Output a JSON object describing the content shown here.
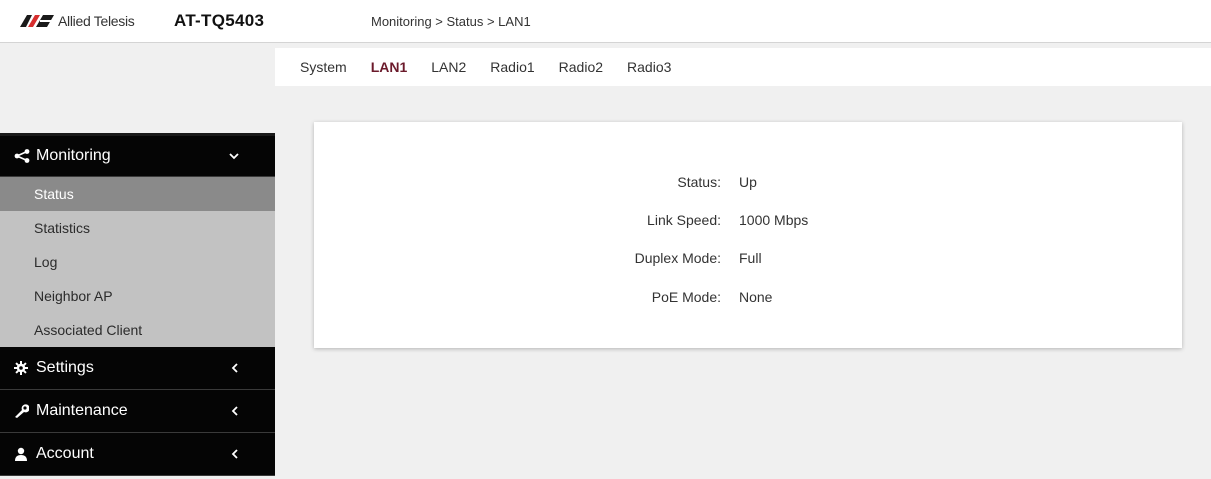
{
  "header": {
    "logo_text": "Allied Telesis",
    "model": "AT-TQ5403",
    "breadcrumb": "Monitoring > Status > LAN1"
  },
  "tabs": [
    {
      "label": "System",
      "active": false
    },
    {
      "label": "LAN1",
      "active": true
    },
    {
      "label": "LAN2",
      "active": false
    },
    {
      "label": "Radio1",
      "active": false
    },
    {
      "label": "Radio2",
      "active": false
    },
    {
      "label": "Radio3",
      "active": false
    }
  ],
  "sidebar": {
    "monitoring": {
      "label": "Monitoring",
      "icon": "share-icon",
      "expanded": true,
      "items": [
        {
          "label": "Status",
          "active": true
        },
        {
          "label": "Statistics",
          "active": false
        },
        {
          "label": "Log",
          "active": false
        },
        {
          "label": "Neighbor AP",
          "active": false
        },
        {
          "label": "Associated Client",
          "active": false
        }
      ]
    },
    "settings": {
      "label": "Settings",
      "icon": "gear-icon"
    },
    "maintenance": {
      "label": "Maintenance",
      "icon": "wrench-icon"
    },
    "account": {
      "label": "Account",
      "icon": "user-icon"
    }
  },
  "status": {
    "status_label": "Status:",
    "status_value": "Up",
    "link_speed_label": "Link Speed:",
    "link_speed_value": "1000 Mbps",
    "duplex_label": "Duplex Mode:",
    "duplex_value": "Full",
    "poe_label": "PoE Mode:",
    "poe_value": "None"
  },
  "colors": {
    "accent": "#6b1a2b",
    "nav_bg": "#050505",
    "subnav_bg": "#c2c2c2",
    "subnav_active": "#8a8a8a"
  }
}
